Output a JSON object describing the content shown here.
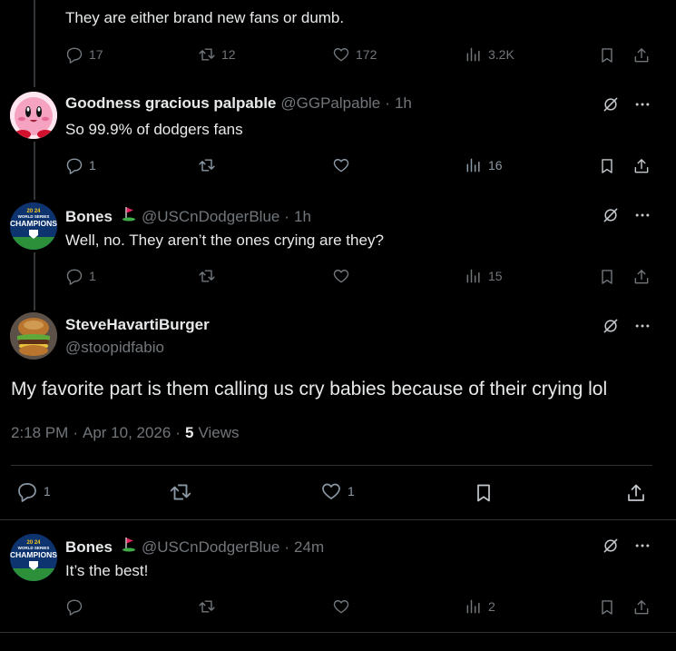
{
  "tweet_top": {
    "text": "They are either brand new fans or dumb.",
    "replies": "17",
    "retweets": "12",
    "likes": "172",
    "views": "3.2K"
  },
  "tweet_goodness": {
    "display_name": "Goodness gracious palpable",
    "handle": "@GGPalpable",
    "time": "1h",
    "text": "So 99.9% of dodgers fans",
    "replies": "1",
    "views": "16"
  },
  "tweet_bones_1": {
    "display_name": "Bones",
    "handle": "@USCnDodgerBlue",
    "time": "1h",
    "text": "Well, no. They aren’t the ones crying are they?",
    "replies": "1",
    "views": "15"
  },
  "main_tweet": {
    "display_name": "SteveHavartiBurger",
    "handle": "@stoopidfabio",
    "text": "My favorite part is them calling us cry babies because of their crying lol",
    "time": "2:18 PM",
    "date": "Apr 10, 2026",
    "views_count": "5",
    "views_label": "Views",
    "replies": "1",
    "likes": "1"
  },
  "tweet_bones_2": {
    "display_name": "Bones",
    "handle": "@USCnDodgerBlue",
    "time": "24m",
    "text": "It’s the best!",
    "views": "2"
  },
  "common": {
    "dot": "·",
    "avatar_badge_top": "20 24",
    "avatar_badge_mid": "WORLD SERIES",
    "avatar_badge_main": "CHAMPIONS"
  },
  "colors": {
    "background": "#000000",
    "text": "#e7e9ea",
    "muted": "#71767b",
    "divider": "#2f3336"
  }
}
